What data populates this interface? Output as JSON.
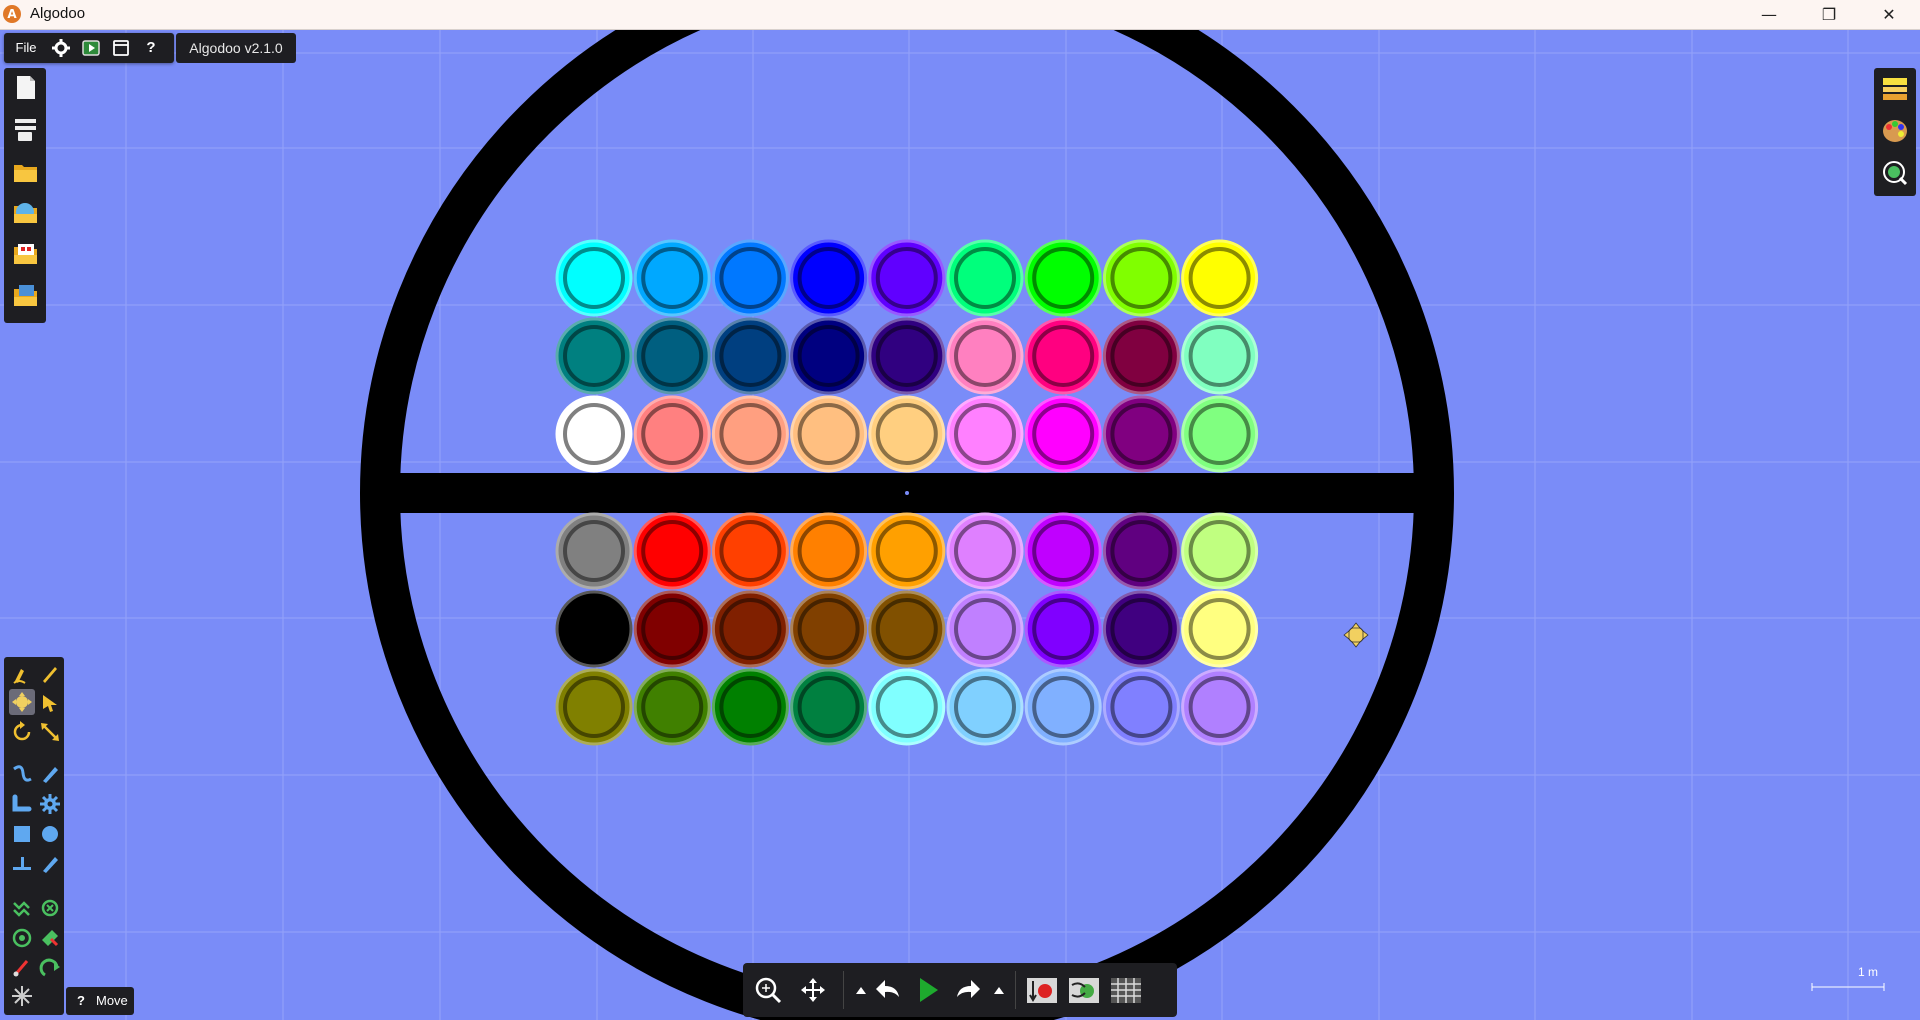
{
  "window": {
    "title": "Algodoo",
    "logo_letter": "A",
    "minimize_glyph": "—",
    "maximize_glyph": "❐",
    "close_glyph": "✕"
  },
  "menu": {
    "file_label": "File",
    "version": "Algodoo v2.1.0"
  },
  "file_panel_icons": [
    "new-scene-icon",
    "scene-bar-icon",
    "open-folder-icon",
    "phunlets-icon",
    "scenes-icon",
    "lessons-icon"
  ],
  "toolbox_icons": [
    "sketch-tool-icon",
    "brush-tool-icon",
    "move-tool-icon",
    "drag-tool-icon",
    "rotate-tool-icon",
    "scale-tool-icon",
    "rope-tool-icon",
    "knife-tool-icon",
    "chain-tool-icon",
    "gear-tool-icon",
    "box-tool-icon",
    "circle-tool-icon",
    "plane-tool-icon",
    "spring-tool-icon",
    "fixate-tool-icon",
    "hinge-tool-icon",
    "axle-tool-icon",
    "thruster-tool-icon",
    "tracer-tool-icon",
    "laser-tool-icon",
    "eraser-tool-icon"
  ],
  "tool_hint": {
    "help_glyph": "?",
    "label": "Move"
  },
  "right_panel_icons": [
    "background-icon",
    "palette-icon",
    "physics-icon"
  ],
  "bottom_toolbar": {
    "icons": [
      "zoom-icon",
      "pan-icon",
      "undo-menu-icon",
      "undo-icon",
      "play-icon",
      "redo-icon",
      "redo-menu-icon",
      "gravity-icon",
      "air-icon",
      "grid-icon"
    ]
  },
  "scale_label": "1 m",
  "colors": {
    "background": "#7a8cf8",
    "grid": "#95a3fa",
    "ring": "#000000"
  },
  "balls": [
    [
      "#00ffff",
      "#00a8ff",
      "#0078ff",
      "#0000ff",
      "#6000ff",
      "#00ff7c",
      "#00ff00",
      "#80ff00",
      "#ffff00"
    ],
    [
      "#008080",
      "#005f80",
      "#003f80",
      "#000080",
      "#300080",
      "#ff80c0",
      "#ff0080",
      "#800040",
      "#80ffc0"
    ],
    [
      "#ffffff",
      "#ff8080",
      "#ff9f80",
      "#ffbf80",
      "#ffcf80",
      "#ff80ff",
      "#ff00ff",
      "#800080",
      "#80ff80"
    ],
    [
      "#808080",
      "#ff0000",
      "#ff4000",
      "#ff8000",
      "#ffa000",
      "#df80ff",
      "#c000ff",
      "#600080",
      "#c0ff80"
    ],
    [
      "#000000",
      "#800000",
      "#802000",
      "#804000",
      "#805000",
      "#c080ff",
      "#8000ff",
      "#400080",
      "#ffff80"
    ],
    [
      "#808000",
      "#408000",
      "#008000",
      "#008040",
      "#80ffff",
      "#80d0ff",
      "#80b0ff",
      "#8080ff",
      "#b080ff"
    ]
  ]
}
